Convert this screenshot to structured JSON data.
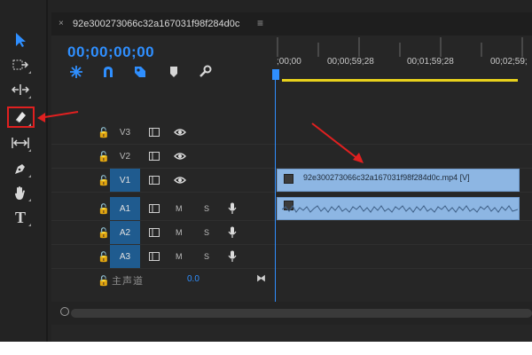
{
  "sequence": {
    "tab_close": "×",
    "name": "92e300273066c32a167031f98f284d0c",
    "tab_menu": "≡",
    "timecode": "00;00;00;00"
  },
  "ruler": {
    "ticks": [
      ";00;00",
      "00;00;59;28",
      "00;01;59;28",
      "00;02;59;"
    ]
  },
  "tracks": {
    "video": [
      {
        "label": "V3",
        "active": false
      },
      {
        "label": "V2",
        "active": false
      },
      {
        "label": "V1",
        "active": true
      }
    ],
    "audio": [
      {
        "label": "A1",
        "active": true,
        "mute": "M",
        "solo": "S"
      },
      {
        "label": "A2",
        "active": true,
        "mute": "M",
        "solo": "S"
      },
      {
        "label": "A3",
        "active": true,
        "mute": "M",
        "solo": "S"
      }
    ],
    "master": {
      "label": "主声道",
      "value": "0.0",
      "icon": "⧓"
    }
  },
  "clips": {
    "video_clip_label": "92e300273066c32a167031f98f284d0c.mp4 [V]"
  },
  "colors": {
    "accent": "#2f8fff",
    "clip": "#8db6e3",
    "track_active": "#1f5b8f",
    "annotation": "#e02020",
    "workarea": "#e8d11c"
  },
  "tools": [
    "selection-tool",
    "track-select-tool",
    "ripple-edit-tool",
    "razor-tool",
    "slip-tool",
    "pen-tool",
    "hand-tool",
    "type-tool"
  ],
  "type_tool_glyph": "T",
  "lock_glyph": "🔓"
}
